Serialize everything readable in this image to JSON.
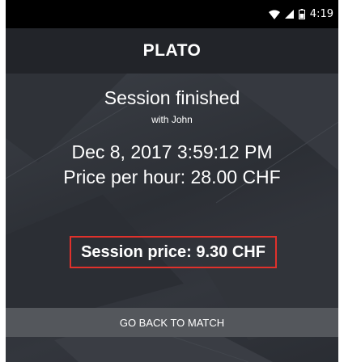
{
  "status_bar": {
    "time": "4:19",
    "icons": [
      "wifi-icon",
      "signal-icon",
      "battery-icon"
    ]
  },
  "app_bar": {
    "title": "PLATO"
  },
  "session": {
    "title": "Session finished",
    "subtitle": "with John",
    "datetime": "Dec 8, 2017 3:59:12 PM",
    "price_per_hour": "Price per hour: 28.00 CHF",
    "session_price": "Session price: 9.30 CHF"
  },
  "actions": {
    "back_label": "GO BACK TO MATCH"
  },
  "colors": {
    "status_bar": "#000000",
    "app_bar": "#222429",
    "background": "#2a2d33",
    "highlight_border": "#e0312b",
    "button": "#54575c",
    "text": "#ffffff"
  }
}
